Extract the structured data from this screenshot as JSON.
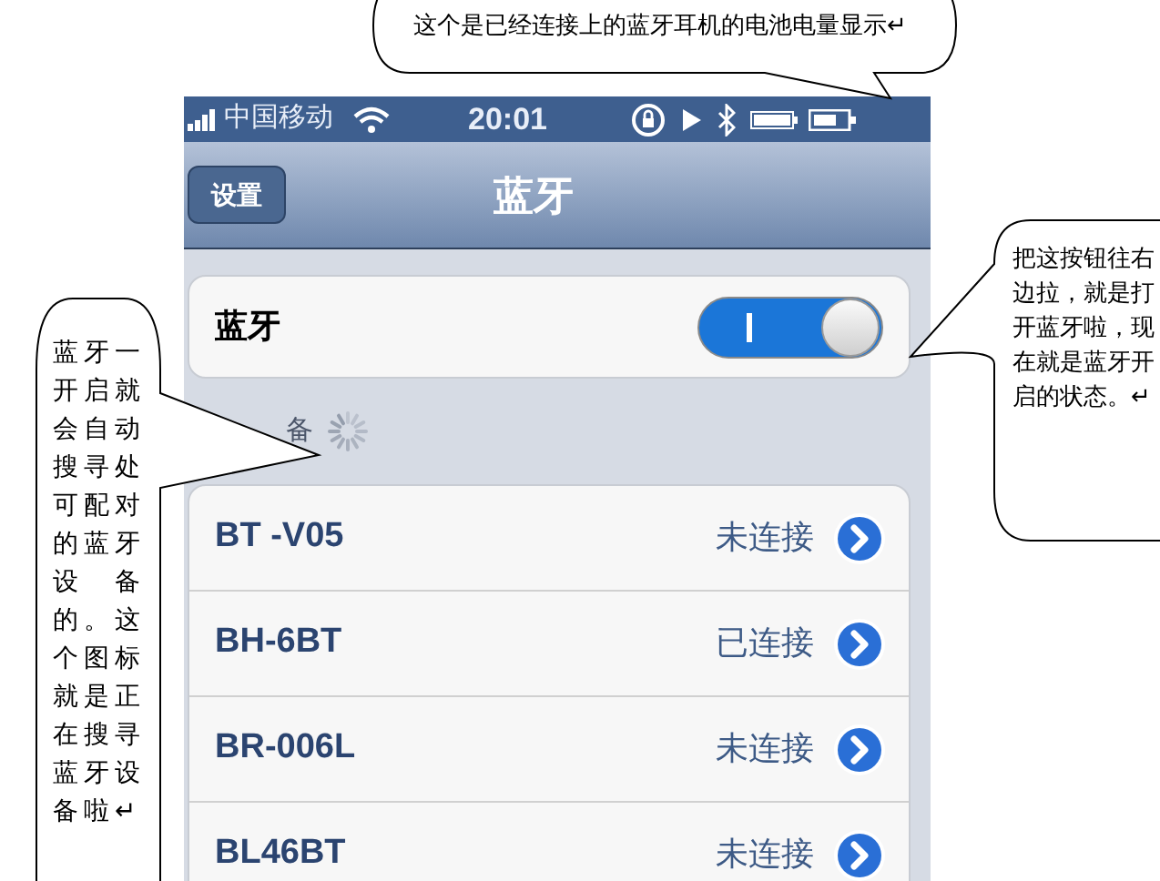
{
  "callouts": [
    {
      "kind": "top",
      "text": "这个是已经连接上的蓝牙耳机的电池电量显示↵"
    },
    {
      "kind": "left",
      "text": "蓝牙一开启就会自动搜寻处可配对的蓝牙设　备的。这个图标就是正在搜寻蓝牙设备啦↵"
    },
    {
      "kind": "right",
      "text": "把这按钮往右边拉，就是打开蓝牙啦，现在就是蓝牙开启的状态。↵"
    }
  ],
  "status_bar": {
    "carrier": "中国移动",
    "time": "20:01"
  },
  "nav_bar": {
    "back": "设置",
    "title": "蓝牙"
  },
  "bluetooth_toggle": {
    "label": "蓝牙",
    "on": true
  },
  "section": {
    "label": "备"
  },
  "devices": [
    {
      "name": "BT -V05",
      "status": "未连接"
    },
    {
      "name": "BH-6BT",
      "status": "已连接"
    },
    {
      "name": "BR-006L",
      "status": "未连接"
    },
    {
      "name": "BL46BT",
      "status": "未连接"
    }
  ]
}
